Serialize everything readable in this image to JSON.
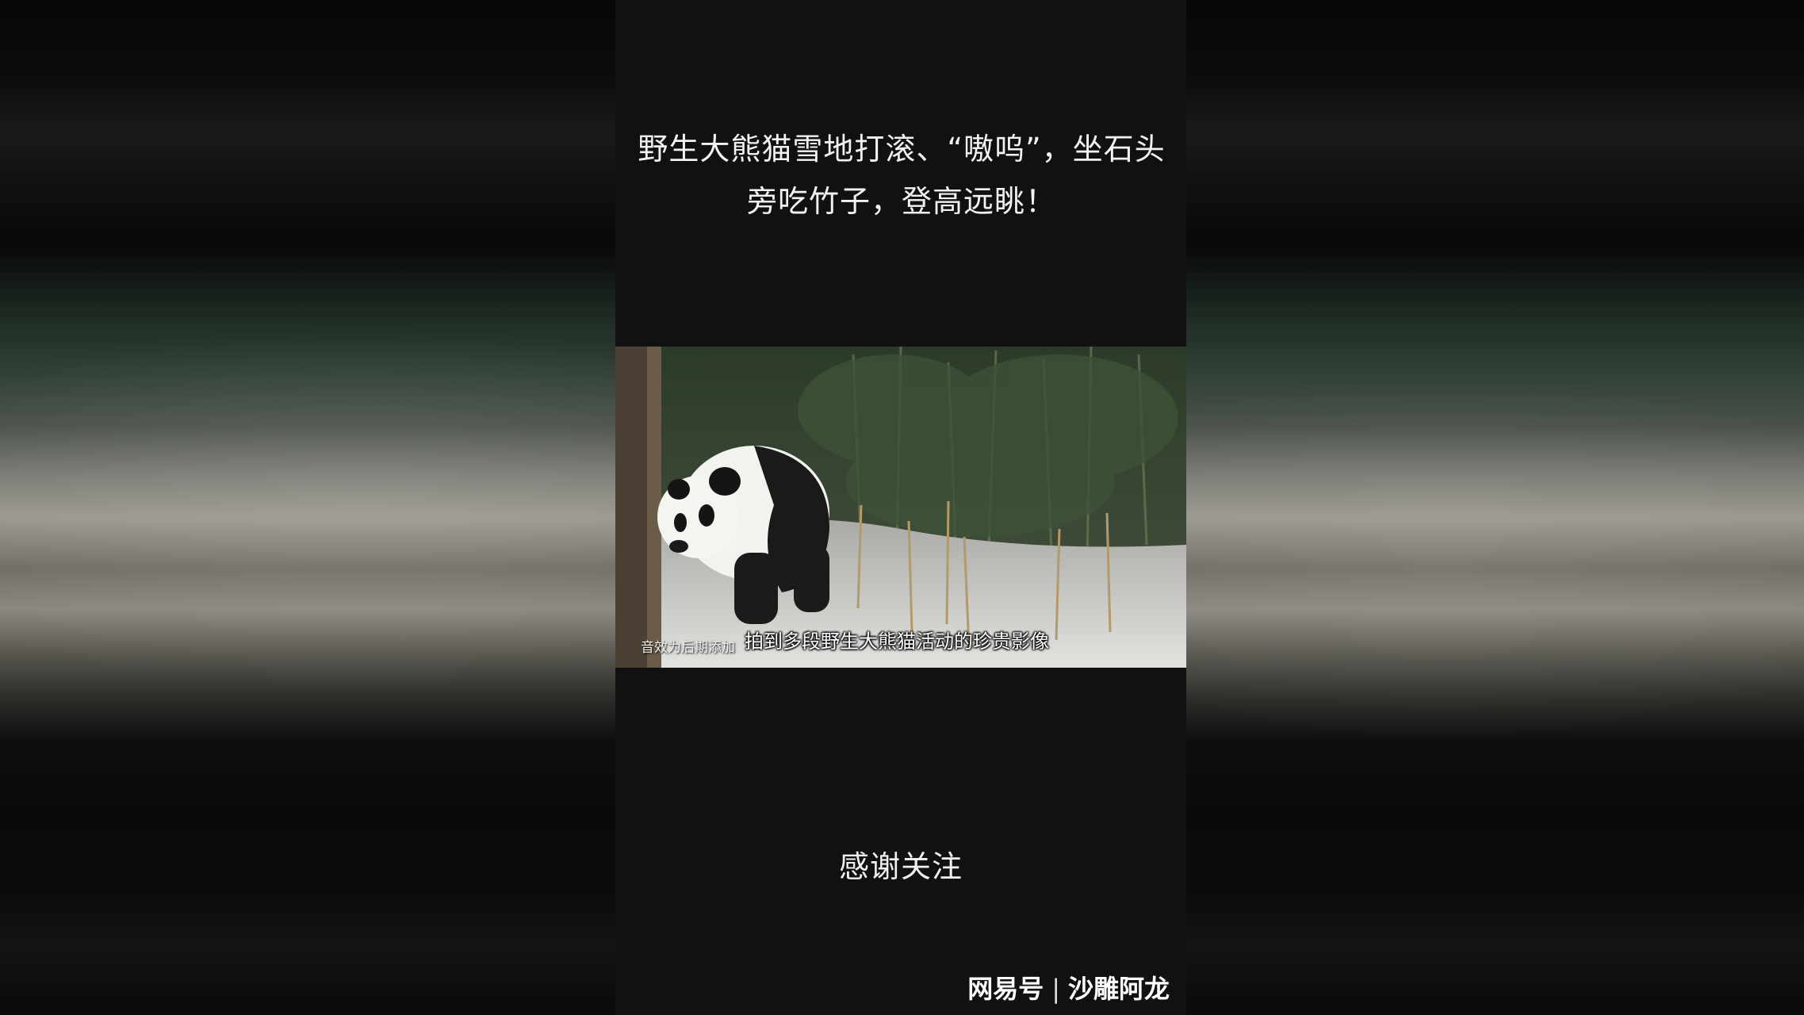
{
  "title": "野生大熊猫雪地打滚、“嗷呜”，坐石头旁吃竹子，登高远眺！",
  "video": {
    "note": "音效为后期添加",
    "subtitle": "拍到多段野生大熊猫活动的珍贵影像"
  },
  "thanks": "感谢关注",
  "watermark": {
    "platform": "网易号",
    "separator": "|",
    "author": "沙雕阿龙"
  },
  "colors": {
    "background": "#111111",
    "text": "#f2f2f2"
  }
}
